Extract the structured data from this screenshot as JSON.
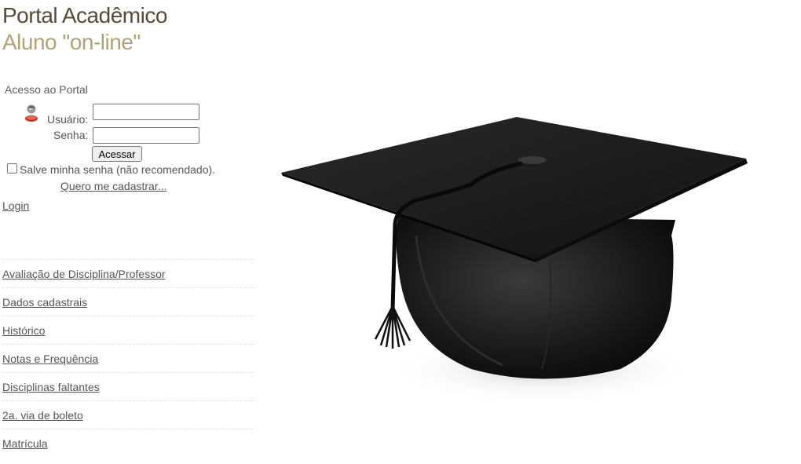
{
  "header": {
    "title": "Portal Acadêmico",
    "subtitle": "Aluno \"on-line\""
  },
  "login": {
    "heading": "Acesso ao Portal",
    "user_icon": "user-avatar-icon",
    "user_label": "Usuário:",
    "user_value": "",
    "password_label": "Senha:",
    "password_value": "",
    "submit_label": "Acessar",
    "remember_label": "Salve minha senha (não recomendado).",
    "remember_checked": false,
    "signup_link": "Quero me cadastrar...",
    "login_link": "Login"
  },
  "menu": {
    "items": [
      {
        "label": "Avaliação de Disciplina/Professor"
      },
      {
        "label": "Dados cadastrais"
      },
      {
        "label": "Histórico"
      },
      {
        "label": "Notas e Frequência"
      },
      {
        "label": "Disciplinas faltantes"
      },
      {
        "label": "2a. via de boleto"
      },
      {
        "label": "Matrícula"
      }
    ]
  },
  "illustration": {
    "icon": "graduation-cap-icon",
    "colors": {
      "cap": "#111111",
      "tassel": "#0a0a0a"
    }
  },
  "colors": {
    "title": "#5a4a38",
    "subtitle": "#b3a077",
    "text": "#555555"
  }
}
